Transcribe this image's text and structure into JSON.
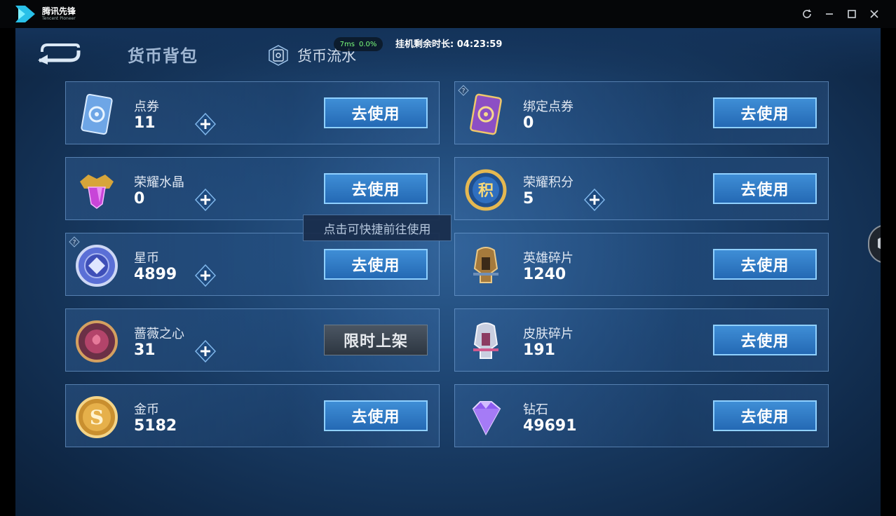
{
  "app": {
    "title_cn": "腾讯先锋",
    "title_en": "Tencent Pioneer"
  },
  "window": {
    "icons": [
      "refresh-icon",
      "minimize-icon",
      "maximize-icon",
      "close-icon"
    ]
  },
  "header": {
    "back_icon": "back-arrow-icon",
    "tab_active": "货币背包",
    "tab_flow": "货币流水",
    "ping": "7ms",
    "loss": "0.0%",
    "timer_label": "挂机剩余时长: 04:23:59"
  },
  "tooltip": "点击可快捷前往使用",
  "currencies": [
    {
      "name": "点券",
      "value": "11",
      "has_plus": true,
      "button": "去使用",
      "icon": "voucher-card-icon"
    },
    {
      "name": "绑定点券",
      "value": "0",
      "has_plus": false,
      "button": "去使用",
      "icon": "bound-voucher-card-icon",
      "has_help": true
    },
    {
      "name": "荣耀水晶",
      "value": "0",
      "has_plus": true,
      "button": "去使用",
      "icon": "glory-crystal-icon"
    },
    {
      "name": "荣耀积分",
      "value": "5",
      "has_plus": true,
      "button": "去使用",
      "icon": "glory-points-icon"
    },
    {
      "name": "星币",
      "value": "4899",
      "has_plus": true,
      "button": "去使用",
      "icon": "star-coin-icon",
      "has_help": true
    },
    {
      "name": "英雄碎片",
      "value": "1240",
      "has_plus": false,
      "button": "去使用",
      "icon": "hero-fragment-icon"
    },
    {
      "name": "蔷薇之心",
      "value": "31",
      "has_plus": true,
      "button": "限时上架",
      "icon": "rose-heart-icon"
    },
    {
      "name": "皮肤碎片",
      "value": "191",
      "has_plus": false,
      "button": "去使用",
      "icon": "skin-fragment-icon"
    },
    {
      "name": "金币",
      "value": "5182",
      "has_plus": false,
      "button": "去使用",
      "icon": "gold-coin-icon"
    },
    {
      "name": "钻石",
      "value": "49691",
      "has_plus": false,
      "button": "去使用",
      "icon": "diamond-icon"
    }
  ],
  "colors": {
    "button_blue": "#2f7fd0",
    "card_border": "#82afe1",
    "background": "#1c426e"
  }
}
